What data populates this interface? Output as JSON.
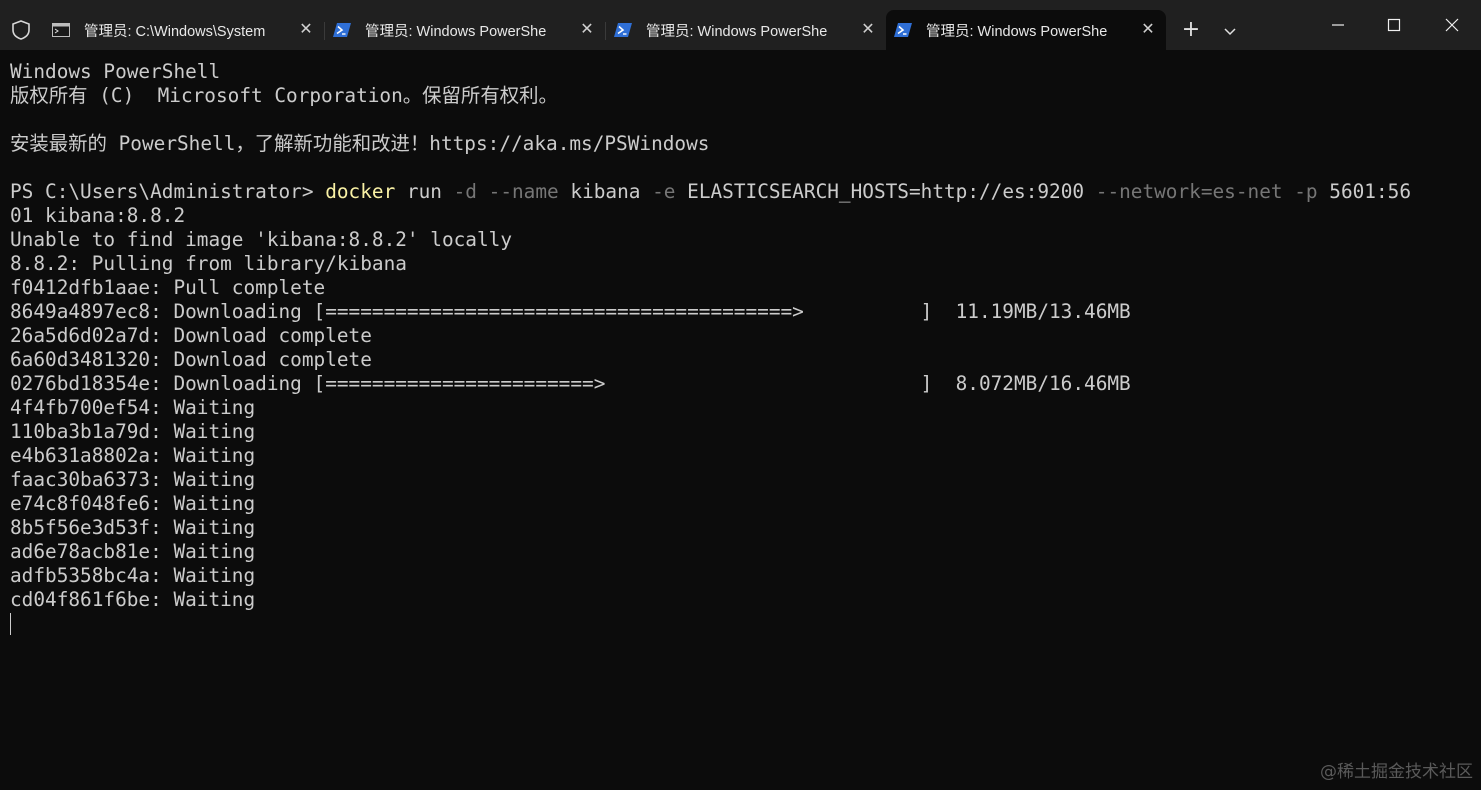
{
  "window": {
    "tabs": [
      {
        "title": "管理员: C:\\Windows\\System",
        "icon": "cmd-icon",
        "active": false
      },
      {
        "title": "管理员: Windows PowerShe",
        "icon": "powershell-icon",
        "active": false
      },
      {
        "title": "管理员: Windows PowerShe",
        "icon": "powershell-icon",
        "active": false
      },
      {
        "title": "管理员: Windows PowerShe",
        "icon": "powershell-icon",
        "active": true
      }
    ],
    "new_tab_label": "+",
    "close_glyph": "✕"
  },
  "terminal": {
    "banner_1": "Windows PowerShell",
    "banner_2": "版权所有 (C)  Microsoft Corporation。保留所有权利。",
    "banner_3": "安装最新的 PowerShell，了解新功能和改进！https://aka.ms/PSWindows",
    "prompt": "PS C:\\Users\\Administrator> ",
    "command": {
      "docker": "docker",
      "run": " run ",
      "flag_d": "-d",
      "flag_name": " --name",
      "name_val": " kibana ",
      "flag_e": "-e",
      "env_val": " ELASTICSEARCH_HOSTS=http://es:9200 ",
      "flag_network": "--network=es-net",
      "space": " ",
      "flag_p": "-p",
      "port_val": " 5601:56"
    },
    "command_wrap": "01 kibana:8.8.2",
    "output": [
      "Unable to find image 'kibana:8.8.2' locally",
      "8.8.2: Pulling from library/kibana",
      "f0412dfb1aae: Pull complete",
      "8649a4897ec8: Downloading [========================================>          ]  11.19MB/13.46MB",
      "26a5d6d02a7d: Download complete",
      "6a60d3481320: Download complete",
      "0276bd18354e: Downloading [=======================>                           ]  8.072MB/16.46MB",
      "4f4fb700ef54: Waiting",
      "110ba3b1a79d: Waiting",
      "e4b631a8802a: Waiting",
      "faac30ba6373: Waiting",
      "e74c8f048fe6: Waiting",
      "8b5f56e3d53f: Waiting",
      "ad6e78acb81e: Waiting",
      "adfb5358bc4a: Waiting",
      "cd04f861f6be: Waiting"
    ]
  },
  "watermark": "@稀土掘金技术社区",
  "colors": {
    "background": "#0c0c0c",
    "titlebar": "#202020",
    "text": "#cccccc",
    "command": "#f9f1a5",
    "flag": "#767676",
    "powershell_icon": "#2f6fd6"
  }
}
